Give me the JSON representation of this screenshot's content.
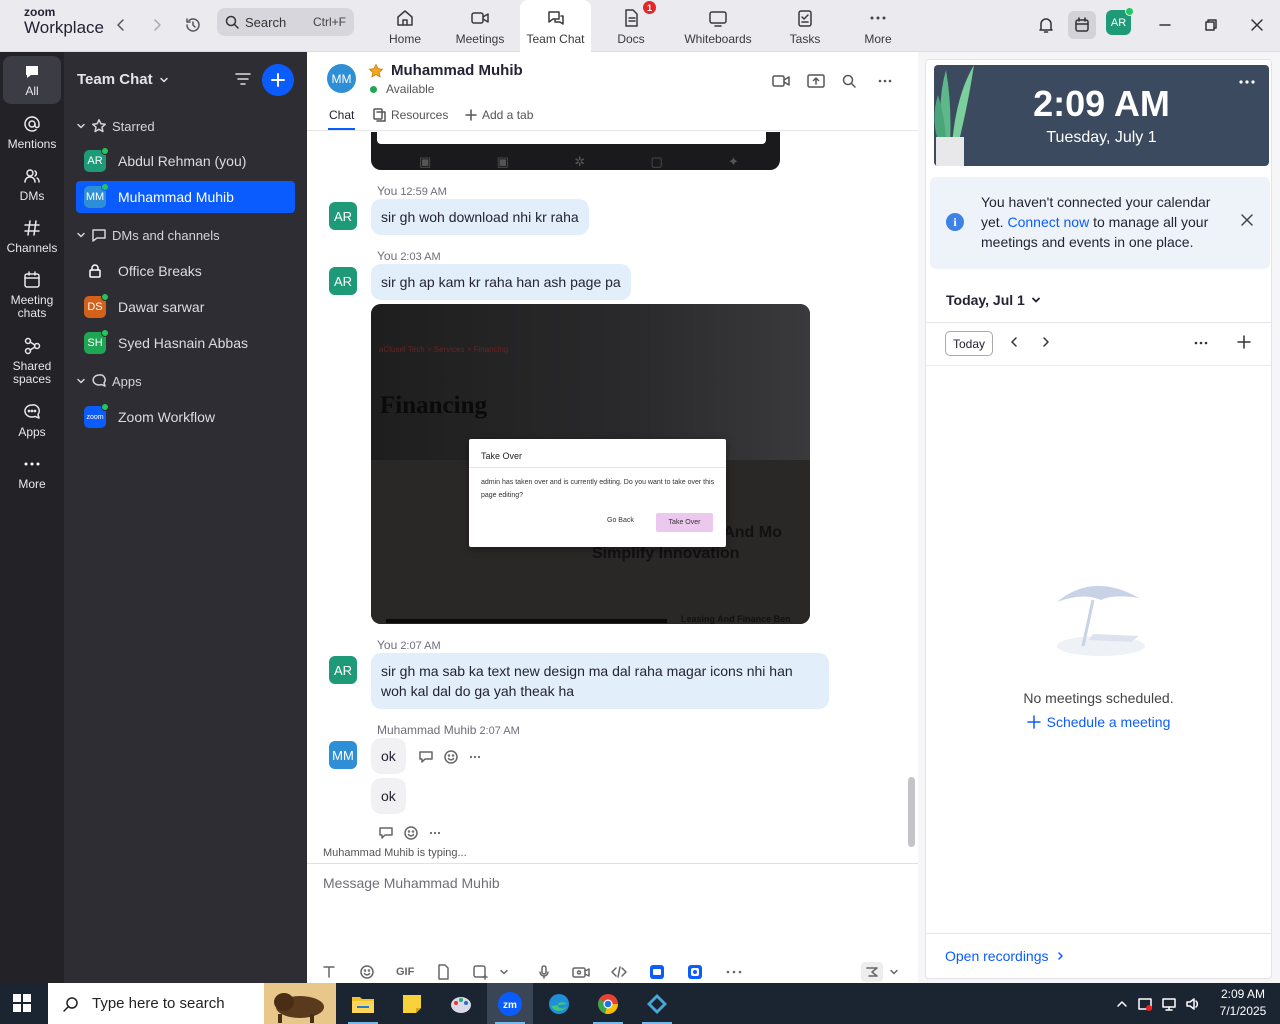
{
  "app": {
    "brand_top": "zoom",
    "brand_bottom": "Workplace"
  },
  "search": {
    "label": "Search",
    "shortcut": "Ctrl+F"
  },
  "nav_tabs": [
    {
      "label": "Home"
    },
    {
      "label": "Meetings"
    },
    {
      "label": "Team Chat"
    },
    {
      "label": "Docs",
      "badge": "1"
    },
    {
      "label": "Whiteboards"
    },
    {
      "label": "Tasks"
    },
    {
      "label": "More"
    }
  ],
  "top_avatar": "AR",
  "rail": [
    {
      "label": "All"
    },
    {
      "label": "Mentions"
    },
    {
      "label": "DMs"
    },
    {
      "label": "Channels"
    },
    {
      "label": "Meeting chats"
    },
    {
      "label": "Shared spaces"
    },
    {
      "label": "Apps"
    },
    {
      "label": "More"
    }
  ],
  "sidebar": {
    "title": "Team Chat",
    "sections": {
      "starred": "Starred",
      "dms": "DMs and channels",
      "apps": "Apps"
    },
    "starred": [
      {
        "initials": "AR",
        "name": "Abdul Rehman (you)",
        "color": "#1f9a78"
      },
      {
        "initials": "MM",
        "name": "Muhammad Muhib",
        "color": "#2e8fd6"
      }
    ],
    "dms": [
      {
        "name": "Office Breaks"
      },
      {
        "initials": "DS",
        "name": "Dawar sarwar",
        "color": "#d4611a"
      },
      {
        "initials": "SH",
        "name": "Syed Hasnain Abbas",
        "color": "#1fa653"
      }
    ],
    "apps": [
      {
        "initials": "zoom",
        "name": "Zoom Workflow",
        "color": "#0b5cff"
      }
    ]
  },
  "chat": {
    "avatar": "MM",
    "name": "Muhammad Muhib",
    "status": "Available",
    "tabs": {
      "chat": "Chat",
      "resources": "Resources",
      "add": "Add a tab"
    },
    "messages": [
      {
        "sender": "You",
        "time": "12:59 AM",
        "avatar": "AR",
        "text": "sir gh woh download nhi kr raha"
      },
      {
        "sender": "You",
        "time": "2:03 AM",
        "avatar": "AR",
        "text": "sir gh ap kam kr raha han ash page pa"
      },
      {
        "sender": "You",
        "time": "2:07 AM",
        "avatar": "AR",
        "text": "sir gh ma sab ka text new design ma dal raha magar icons nhi han woh kal dal do ga yah theak ha"
      },
      {
        "sender": "Muhammad Muhib",
        "time": "2:07 AM",
        "avatar": "MM",
        "text": "ok"
      },
      {
        "text": "ok"
      }
    ],
    "attachment": {
      "breadcrumb": [
        "aClusel Tech",
        "Services",
        "Financing"
      ],
      "page_title": "Financing",
      "dialog_title": "Take Over",
      "dialog_body": "admin has taken over and is currently editing. Do you want to take over this page editing?",
      "go_back": "Go Back",
      "take_over": "Take Over",
      "bg_text_1": "le And Mo",
      "bg_text_2": "Simplify Innovation",
      "bg_text_3": "Leasing And Finance Ben"
    },
    "typing": "Muhammad Muhib  is typing...",
    "composer_placeholder": "Message Muhammad Muhib",
    "composer_tools": {
      "gif": "GIF"
    }
  },
  "right": {
    "time": "2:09 AM",
    "date": "Tuesday, July 1",
    "notice_pre": "You haven't connected your calendar yet.",
    "notice_link": "Connect now",
    "notice_post": "to manage all your meetings and events in one place.",
    "day": "Today, Jul 1",
    "today_btn": "Today",
    "empty": "No meetings scheduled.",
    "schedule": "Schedule a meeting",
    "recordings": "Open recordings"
  },
  "taskbar": {
    "search": "Type here to search",
    "time": "2:09 AM",
    "date": "7/1/2025",
    "zoom_label": "zm"
  },
  "colors": {
    "accent": "#0b5cff",
    "sidebar": "#2d2d33",
    "rail": "#222227",
    "bubble": "#e3eefb",
    "available": "#1fa653"
  }
}
